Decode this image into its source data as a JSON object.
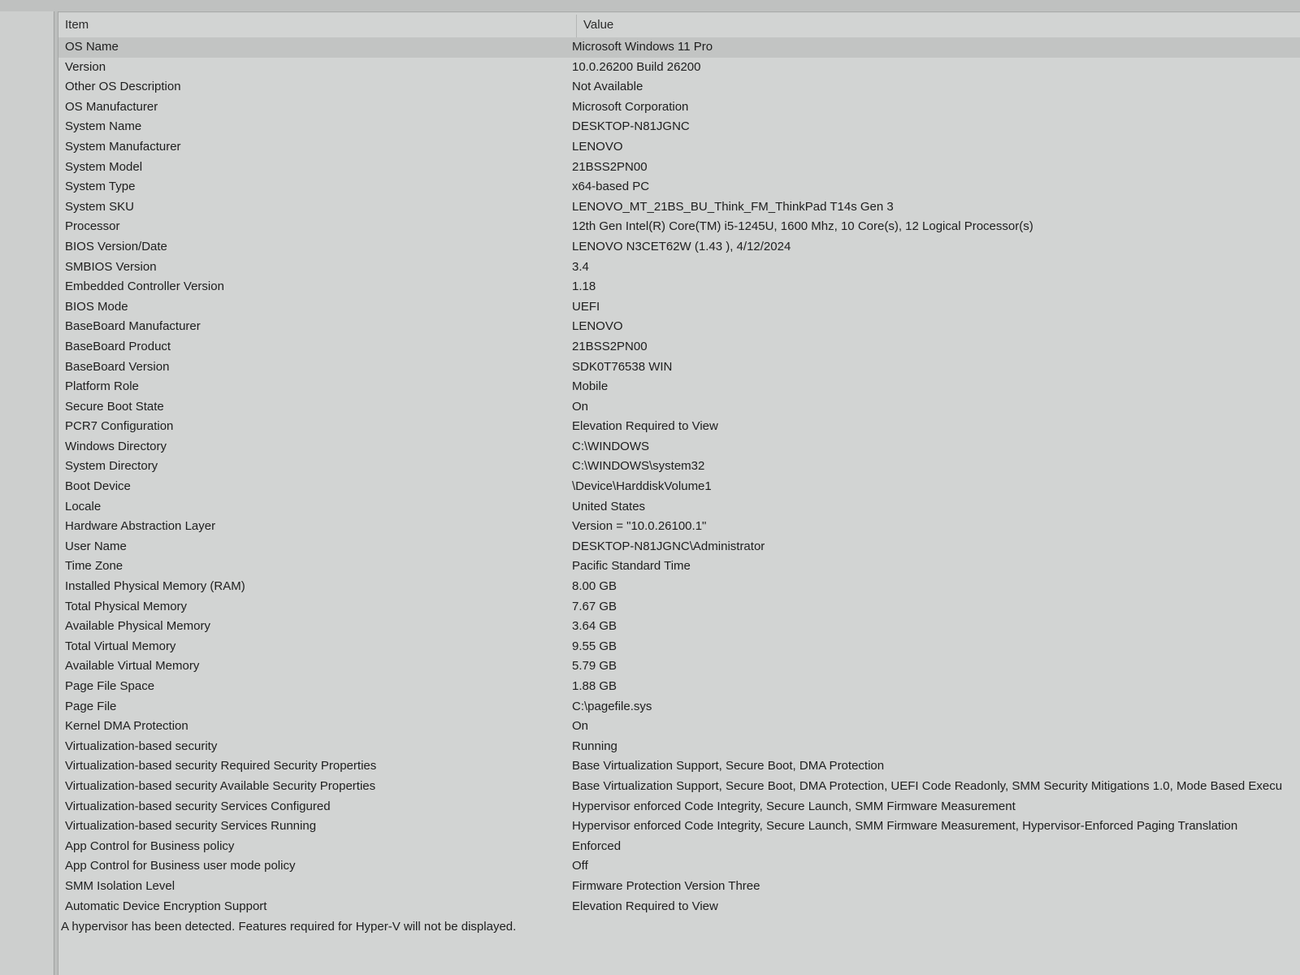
{
  "columns": {
    "item": "Item",
    "value": "Value"
  },
  "rows": [
    {
      "item": "OS Name",
      "value": "Microsoft Windows 11 Pro"
    },
    {
      "item": "Version",
      "value": "10.0.26200 Build 26200"
    },
    {
      "item": "Other OS Description",
      "value": "Not Available"
    },
    {
      "item": "OS Manufacturer",
      "value": "Microsoft Corporation"
    },
    {
      "item": "System Name",
      "value": "DESKTOP-N81JGNC"
    },
    {
      "item": "System Manufacturer",
      "value": "LENOVO"
    },
    {
      "item": "System Model",
      "value": "21BSS2PN00"
    },
    {
      "item": "System Type",
      "value": "x64-based PC"
    },
    {
      "item": "System SKU",
      "value": "LENOVO_MT_21BS_BU_Think_FM_ThinkPad T14s Gen 3"
    },
    {
      "item": "Processor",
      "value": "12th Gen Intel(R) Core(TM) i5-1245U, 1600 Mhz, 10 Core(s), 12 Logical Processor(s)"
    },
    {
      "item": "BIOS Version/Date",
      "value": "LENOVO N3CET62W (1.43 ), 4/12/2024"
    },
    {
      "item": "SMBIOS Version",
      "value": "3.4"
    },
    {
      "item": "Embedded Controller Version",
      "value": "1.18"
    },
    {
      "item": "BIOS Mode",
      "value": "UEFI"
    },
    {
      "item": "BaseBoard Manufacturer",
      "value": "LENOVO"
    },
    {
      "item": "BaseBoard Product",
      "value": "21BSS2PN00"
    },
    {
      "item": "BaseBoard Version",
      "value": "SDK0T76538 WIN"
    },
    {
      "item": "Platform Role",
      "value": "Mobile"
    },
    {
      "item": "Secure Boot State",
      "value": "On"
    },
    {
      "item": "PCR7 Configuration",
      "value": "Elevation Required to View"
    },
    {
      "item": "Windows Directory",
      "value": "C:\\WINDOWS"
    },
    {
      "item": "System Directory",
      "value": "C:\\WINDOWS\\system32"
    },
    {
      "item": "Boot Device",
      "value": "\\Device\\HarddiskVolume1"
    },
    {
      "item": "Locale",
      "value": "United States"
    },
    {
      "item": "Hardware Abstraction Layer",
      "value": "Version = \"10.0.26100.1\""
    },
    {
      "item": "User Name",
      "value": "DESKTOP-N81JGNC\\Administrator"
    },
    {
      "item": "Time Zone",
      "value": "Pacific Standard Time"
    },
    {
      "item": "Installed Physical Memory (RAM)",
      "value": "8.00 GB"
    },
    {
      "item": "Total Physical Memory",
      "value": "7.67 GB"
    },
    {
      "item": "Available Physical Memory",
      "value": "3.64 GB"
    },
    {
      "item": "Total Virtual Memory",
      "value": "9.55 GB"
    },
    {
      "item": "Available Virtual Memory",
      "value": "5.79 GB"
    },
    {
      "item": "Page File Space",
      "value": "1.88 GB"
    },
    {
      "item": "Page File",
      "value": "C:\\pagefile.sys"
    },
    {
      "item": "Kernel DMA Protection",
      "value": "On"
    },
    {
      "item": "Virtualization-based security",
      "value": "Running"
    },
    {
      "item": "Virtualization-based security Required Security Properties",
      "value": "Base Virtualization Support, Secure Boot, DMA Protection"
    },
    {
      "item": "Virtualization-based security Available Security Properties",
      "value": "Base Virtualization Support, Secure Boot, DMA Protection, UEFI Code Readonly, SMM Security Mitigations 1.0, Mode Based Execu"
    },
    {
      "item": "Virtualization-based security Services Configured",
      "value": "Hypervisor enforced Code Integrity, Secure Launch, SMM Firmware Measurement"
    },
    {
      "item": "Virtualization-based security Services Running",
      "value": "Hypervisor enforced Code Integrity, Secure Launch, SMM Firmware Measurement, Hypervisor-Enforced Paging Translation"
    },
    {
      "item": "App Control for Business policy",
      "value": "Enforced"
    },
    {
      "item": "App Control for Business user mode policy",
      "value": "Off"
    },
    {
      "item": "SMM Isolation Level",
      "value": "Firmware Protection Version Three"
    },
    {
      "item": "Automatic Device Encryption Support",
      "value": "Elevation Required to View"
    }
  ],
  "footer_note": "A hypervisor has been detected. Features required for Hyper-V will not be displayed."
}
